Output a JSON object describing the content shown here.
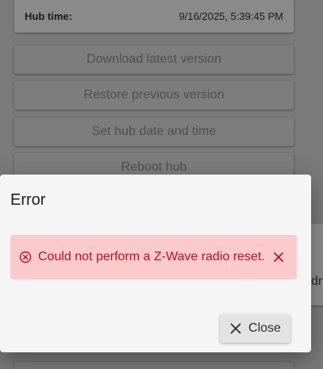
{
  "background": {
    "hub_time_label": "Hub time:",
    "hub_time_value": "9/16/2025, 5:39:45 PM",
    "buttons": [
      "Download latest version",
      "Restore previous version",
      "Set hub date and time",
      "Reboot hub"
    ],
    "side_card_text": "dre"
  },
  "dialog": {
    "title": "Error",
    "alert": {
      "icon": "error-circle-icon",
      "message": "Could not perform a Z-Wave radio reset.",
      "dismiss_icon": "close-icon"
    },
    "close_button": {
      "label": "Close",
      "icon": "close-icon"
    }
  },
  "colors": {
    "alert_background": "#fbcbcb",
    "alert_text": "#b3112f",
    "dialog_background": "#f5f5f5"
  }
}
